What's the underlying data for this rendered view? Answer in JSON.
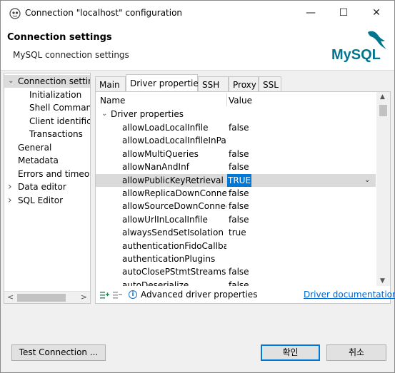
{
  "window": {
    "title": "Connection \"localhost\" configuration",
    "controls": {
      "minimize": "—",
      "maximize": "☐",
      "close": "✕"
    }
  },
  "header": {
    "title": "Connection settings",
    "subtitle": "MySQL connection settings",
    "logo_text": "MySQL"
  },
  "nav_tree": [
    {
      "label": "Connection settings",
      "level": 0,
      "expanded": true,
      "selected": true,
      "has_arrow": true
    },
    {
      "label": "Initialization",
      "level": 1
    },
    {
      "label": "Shell Commands",
      "level": 1
    },
    {
      "label": "Client identification",
      "level": 1
    },
    {
      "label": "Transactions",
      "level": 1
    },
    {
      "label": "General",
      "level": 0
    },
    {
      "label": "Metadata",
      "level": 0
    },
    {
      "label": "Errors and timeouts",
      "level": 0
    },
    {
      "label": "Data editor",
      "level": 0,
      "has_arrow": true
    },
    {
      "label": "SQL Editor",
      "level": 0,
      "has_arrow": true
    }
  ],
  "tabs": [
    {
      "label": "Main",
      "active": false
    },
    {
      "label": "Driver properties",
      "active": true
    },
    {
      "label": "SSH",
      "active": false
    },
    {
      "label": "Proxy",
      "active": false
    },
    {
      "label": "SSL",
      "active": false
    }
  ],
  "table": {
    "columns": {
      "name": "Name",
      "value": "Value"
    },
    "group": "Driver properties",
    "rows": [
      {
        "name": "allowLoadLocalInfile",
        "value": "false"
      },
      {
        "name": "allowLoadLocalInfileInPath",
        "value": ""
      },
      {
        "name": "allowMultiQueries",
        "value": "false"
      },
      {
        "name": "allowNanAndInf",
        "value": "false"
      },
      {
        "name": "allowPublicKeyRetrieval",
        "value": "TRUE",
        "selected": true
      },
      {
        "name": "allowReplicaDownConnections",
        "value": "false"
      },
      {
        "name": "allowSourceDownConnections",
        "value": "false"
      },
      {
        "name": "allowUrlInLocalInfile",
        "value": "false"
      },
      {
        "name": "alwaysSendSetIsolation",
        "value": "true"
      },
      {
        "name": "authenticationFidoCallbackHandler",
        "value": ""
      },
      {
        "name": "authenticationPlugins",
        "value": ""
      },
      {
        "name": "autoClosePStmtStreams",
        "value": "false"
      },
      {
        "name": "autoDeserialize",
        "value": "false"
      }
    ]
  },
  "bottom_bar": {
    "advanced_label": "Advanced driver properties",
    "doc_link": "Driver documentation"
  },
  "buttons": {
    "test_connection": "Test Connection ...",
    "ok": "확인",
    "cancel": "취소"
  },
  "colors": {
    "selection": "#0078d7",
    "link": "#0066cc",
    "logo_blue": "#00758f",
    "logo_orange": "#f29111"
  }
}
